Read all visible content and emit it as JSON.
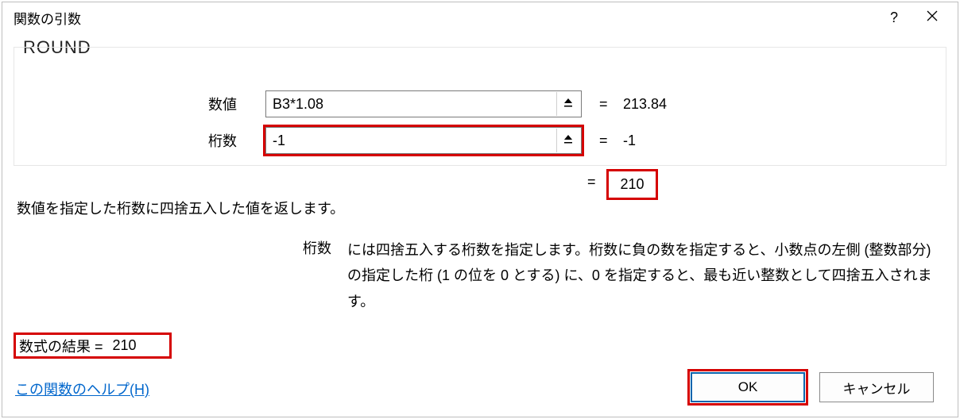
{
  "dialog": {
    "title": "関数の引数",
    "function_name": "ROUND",
    "args": {
      "number": {
        "label": "数値",
        "value": "B3*1.08",
        "evaluated": "213.84"
      },
      "digits": {
        "label": "桁数",
        "value": "-1",
        "evaluated": "-1"
      }
    },
    "intermediate_result": "210",
    "description_main": "数値を指定した桁数に四捨五入した値を返します。",
    "description_arg_label": "桁数",
    "description_arg_text": "には四捨五入する桁数を指定します。桁数に負の数を指定すると、小数点の左側 (整数部分) の指定した桁 (1 の位を 0 とする) に、0 を指定すると、最も近い整数として四捨五入されます。",
    "formula_result_label": "数式の結果 = ",
    "formula_result_value": "210",
    "help_link": "この関数のヘルプ(H)",
    "ok": "OK",
    "cancel": "キャンセル"
  }
}
